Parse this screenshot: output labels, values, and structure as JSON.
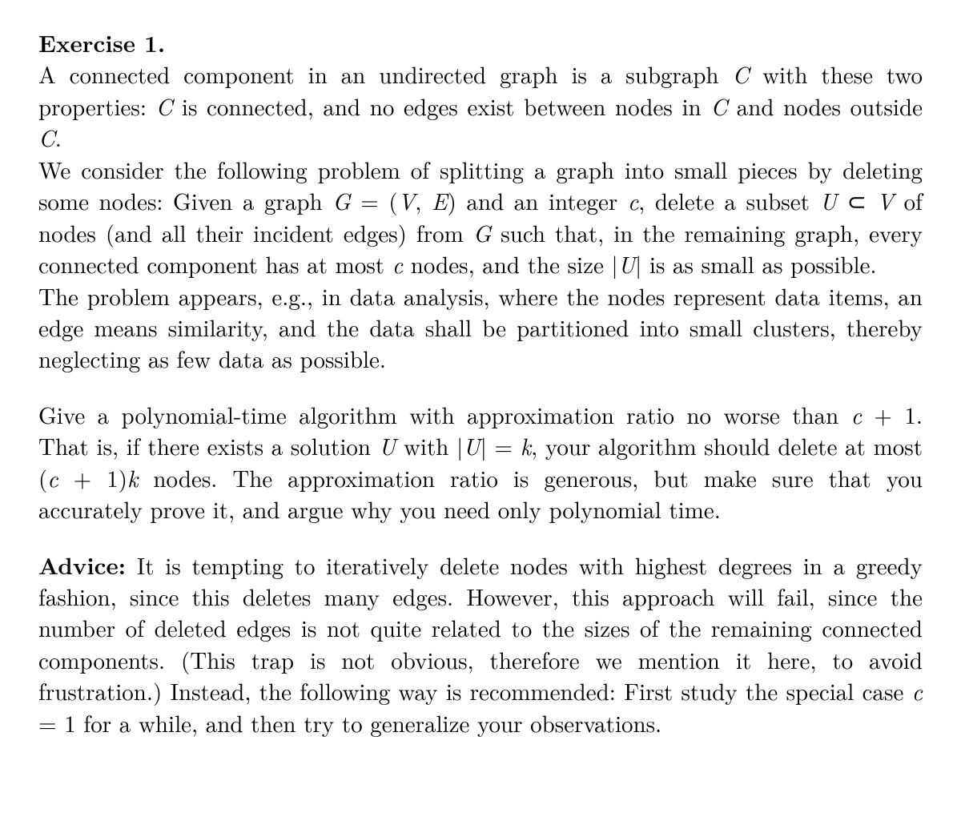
{
  "heading": "Exercise 1.",
  "p1a": "A connected component in an undirected graph is a subgraph ",
  "m1": "C",
  "p1b": " with these two properties: ",
  "m2": "C",
  "p1c": " is connected, and no edges exist between nodes in ",
  "m3": "C",
  "p1d": " and nodes outside ",
  "m4": "C",
  "p1e": ".",
  "p2a": "We consider the following problem of splitting a graph into small pieces by deleting some nodes: Given a graph ",
  "m5": "G",
  "eq1a": " = (",
  "m6": "V",
  "eq1b": ", ",
  "m7": "E",
  "eq1c": ")",
  "p2b": " and an integer ",
  "m8": "c",
  "p2c": ", delete a subset ",
  "m9": "U",
  "subset": " ⊂ ",
  "m10": "V",
  "p2d": " of nodes (and all their incident edges) from ",
  "m11": "G",
  "p2e": " such that, in the remaining graph, every connected component has at most ",
  "m12": "c",
  "p2f": " nodes, and the size ",
  "bar1": "|",
  "m13": "U",
  "bar2": "|",
  "p2g": " is as small as possible.",
  "p3": "The problem appears, e.g., in data analysis, where the nodes represent data items, an edge means similarity, and the data shall be partitioned into small clusters, thereby neglecting as few data as possible.",
  "p4a": "Give a polynomial-time algorithm with approximation ratio no worse than ",
  "m14": "c",
  "plus1a": " + 1",
  "p4b": ". That is, if there exists a solution ",
  "m15": "U",
  "p4c": " with ",
  "bar3": "|",
  "m16": "U",
  "bar4": "|",
  "eqk": " = ",
  "m17": "k",
  "p4d": ", your algorithm should delete at most ",
  "lp": "(",
  "m18": "c",
  "plus1b": " + 1)",
  "m19": "k",
  "p4e": " nodes. The approximation ratio is generous, but make sure that you accurately prove it, and argue why you need only polynomial time.",
  "advice_label": "Advice:",
  "p5a": " It is tempting to iteratively delete nodes with highest degrees in a greedy fashion, since this deletes many edges. However, this approach will fail, since the number of deleted edges is not quite related to the sizes of the remaining connected components. (This trap is not obvious, therefore we mention it here, to avoid frustration.) Instead, the following way is recommended: First study the special case ",
  "m20": "c",
  "eq1": " = 1",
  "p5b": " for a while, and then try to generalize your observations."
}
